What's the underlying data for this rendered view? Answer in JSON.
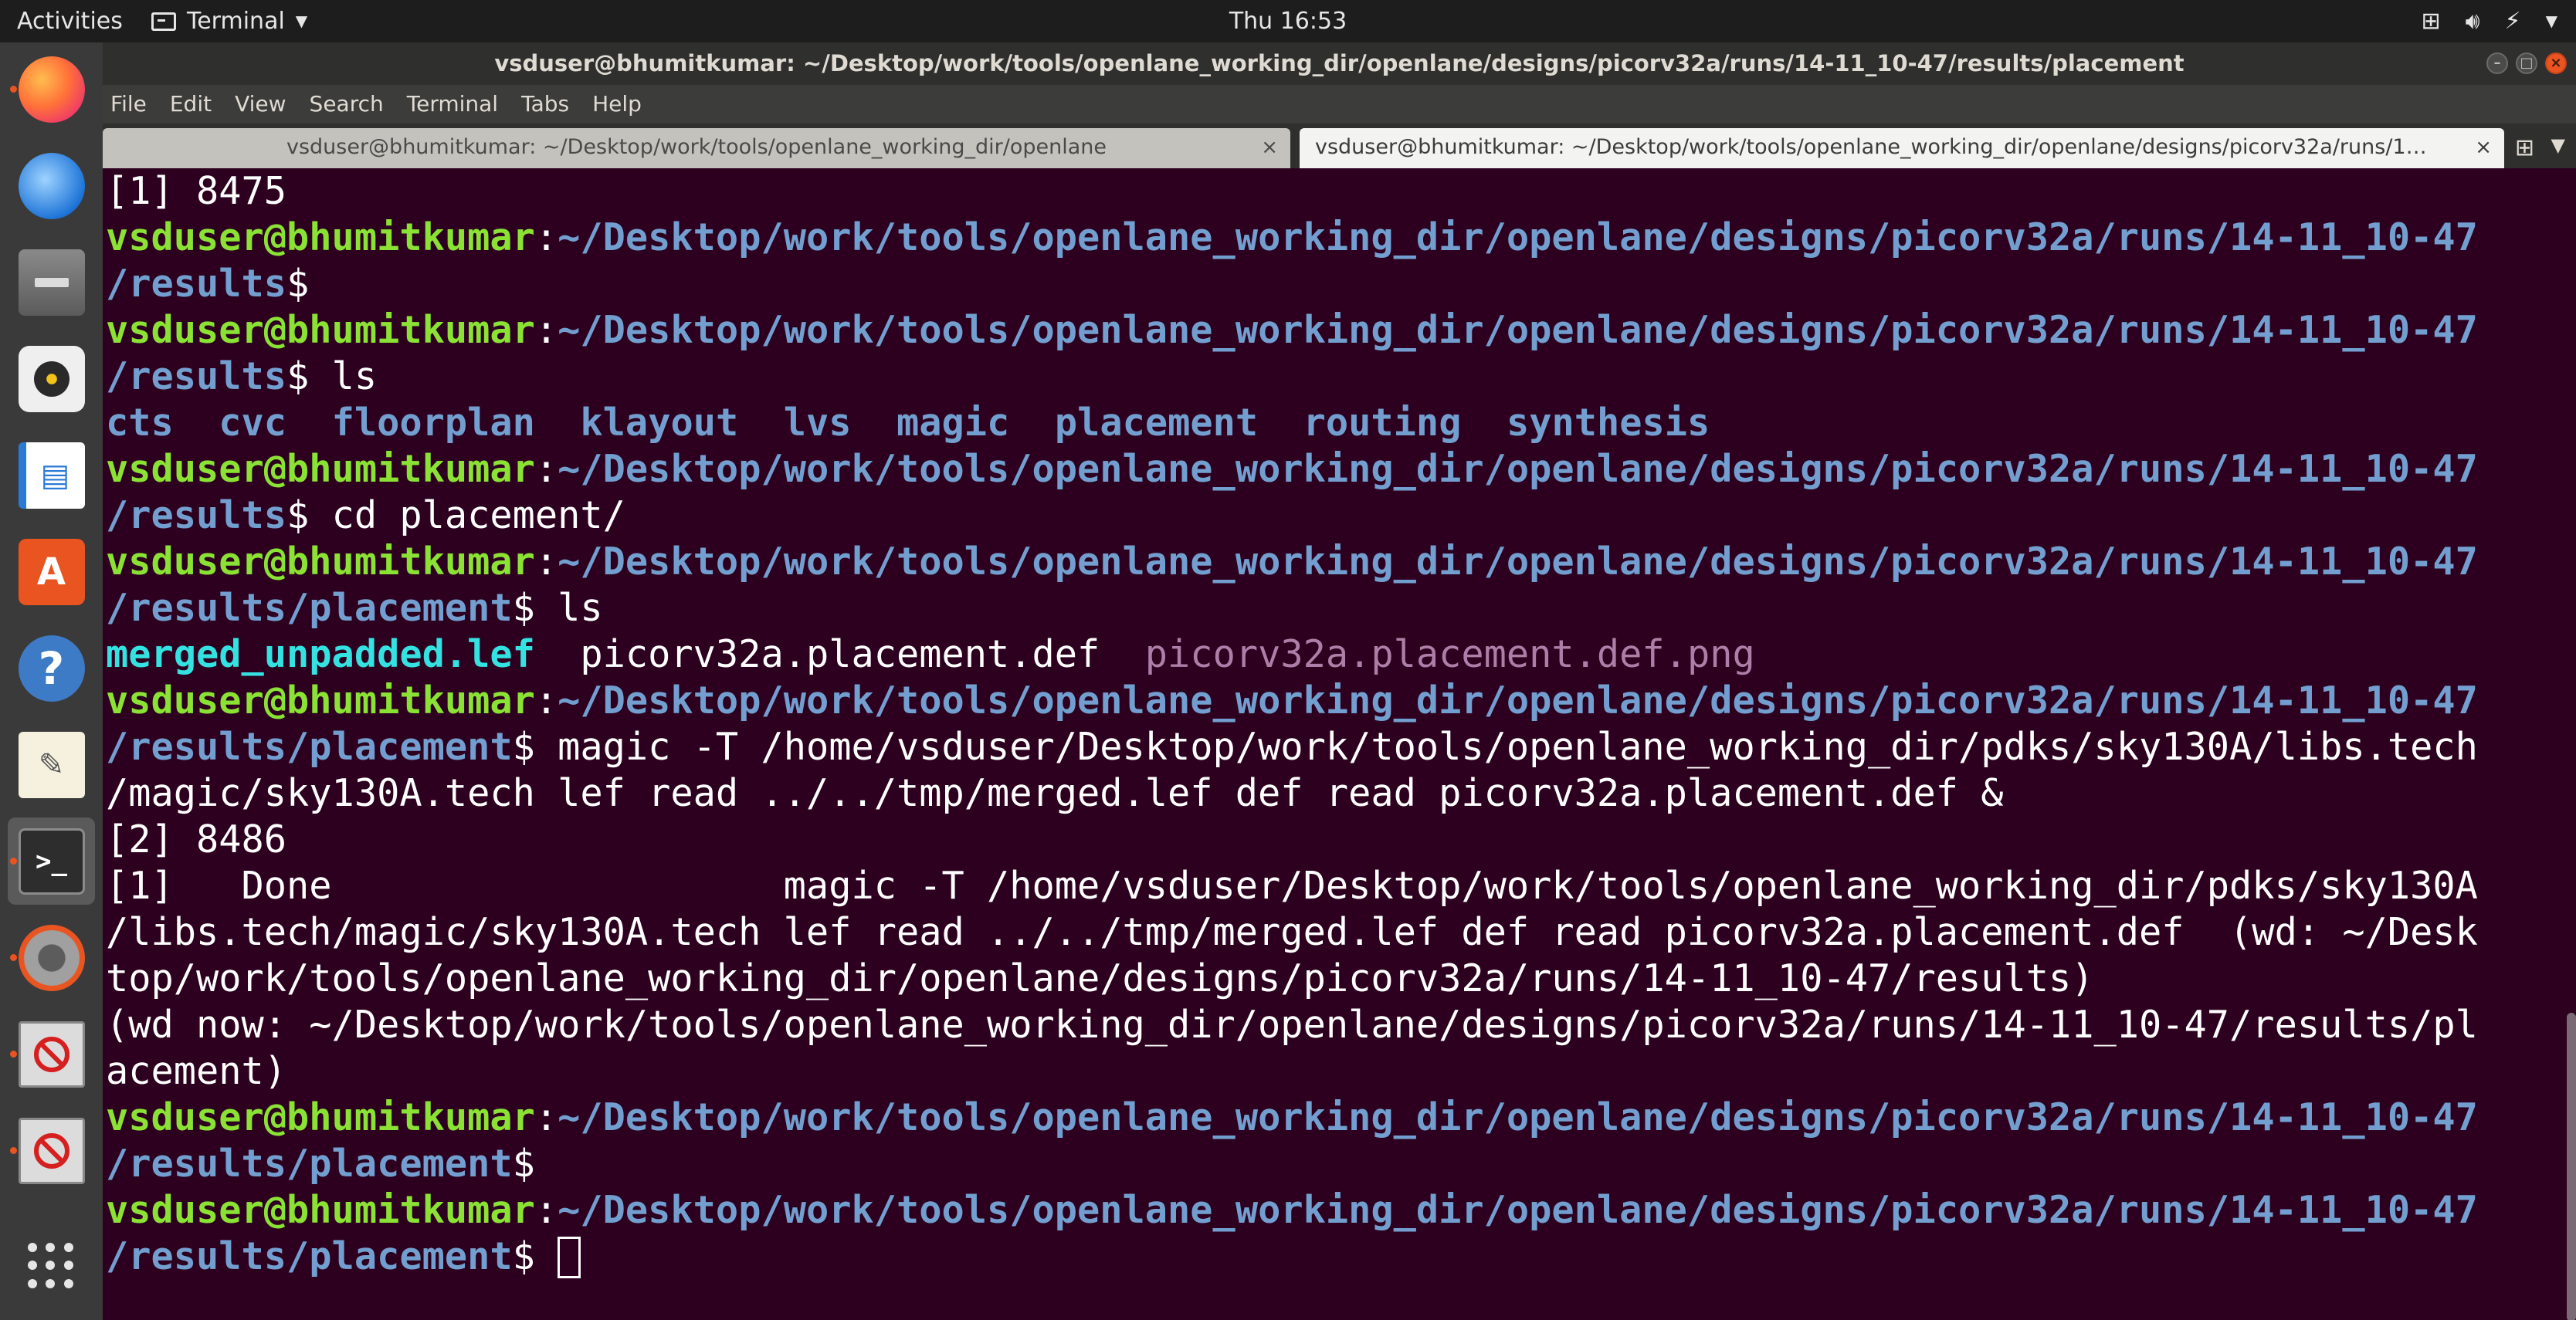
{
  "topbar": {
    "activities": "Activities",
    "app_menu": "Terminal",
    "clock": "Thu 16:53"
  },
  "dock": {
    "items": [
      "firefox",
      "thunderbird",
      "files",
      "rhythmbox",
      "libreoffice-writer",
      "ubuntu-software",
      "help",
      "text-editor",
      "terminal",
      "settings",
      "blocked-app",
      "blocked-app"
    ],
    "software_glyph": "A",
    "help_glyph": "?",
    "terminal_glyph": ">_"
  },
  "window": {
    "title": "vsduser@bhumitkumar: ~/Desktop/work/tools/openlane_working_dir/openlane/designs/picorv32a/runs/14-11_10-47/results/placement"
  },
  "menubar": [
    "File",
    "Edit",
    "View",
    "Search",
    "Terminal",
    "Tabs",
    "Help"
  ],
  "tabs": [
    {
      "label": "vsduser@bhumitkumar: ~/Desktop/work/tools/openlane_working_dir/openlane",
      "close": "×"
    },
    {
      "label": "vsduser@bhumitkumar: ~/Desktop/work/tools/openlane_working_dir/openlane/designs/picorv32a/runs/1…",
      "close": "×"
    }
  ],
  "colors": {
    "background": "#2c001e",
    "user": "#8ae234",
    "path": "#729fcf",
    "directory": "#729fcf",
    "executable": "#34e2e2",
    "image_file": "#ad7fa8"
  },
  "terminal": {
    "user": "vsduser@bhumitkumar",
    "path_main": "~/Desktop/work/tools/openlane_working_dir/openlane/designs/picorv32a/runs/14-11_10-47",
    "path_results": "/results",
    "path_placement": "/results/placement",
    "job_1": "[1] 8475",
    "cmd_ls": " ls",
    "cmd_cd": " cd placement/",
    "dirs": [
      "cts",
      "cvc",
      "floorplan",
      "klayout",
      "lvs",
      "magic",
      "placement",
      "routing",
      "synthesis"
    ],
    "files": {
      "lef": "merged_unpadded.lef",
      "def": "picorv32a.placement.def",
      "png": "picorv32a.placement.def.png"
    },
    "magic_cmd_1": " magic -T /home/vsduser/Desktop/work/tools/openlane_working_dir/pdks/sky130A/libs.tech",
    "magic_cmd_2": "/magic/sky130A.tech lef read ../../tmp/merged.lef def read picorv32a.placement.def &",
    "job_2": "[2] 8486",
    "done_1": "[1]   Done                    magic -T /home/vsduser/Desktop/work/tools/openlane_working_dir/pdks/sky130A",
    "done_2": "/libs.tech/magic/sky130A.tech lef read ../../tmp/merged.lef def read picorv32a.placement.def  (wd: ~/Desk",
    "done_3": "top/work/tools/openlane_working_dir/openlane/designs/picorv32a/runs/14-11_10-47/results)",
    "wd_1": "(wd now: ~/Desktop/work/tools/openlane_working_dir/openlane/designs/picorv32a/runs/14-11_10-47/results/pl",
    "wd_2": "acement)",
    "sep": ":",
    "dollar": "$"
  }
}
